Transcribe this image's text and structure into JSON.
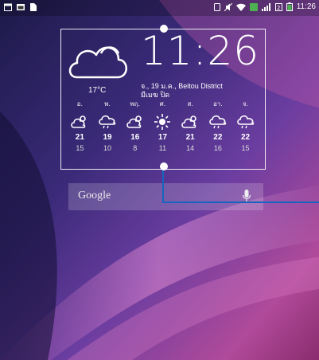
{
  "statusbar": {
    "left_icons": [
      "calendar-icon",
      "message-icon",
      "document-icon"
    ],
    "right_icons": [
      "sim-icon",
      "mute-icon",
      "wifi-icon",
      "app-notification-icon",
      "signal-icon",
      "sim-2-icon",
      "battery-icon"
    ],
    "time": "11:26"
  },
  "widget": {
    "current_icon": "cloud-icon",
    "current_temp": "17°C",
    "time": "11:26",
    "date_line": "จ., 19 ม.ค., Beitou District",
    "date_line2": "มีเมฆ  ปิด",
    "forecast": [
      {
        "day": "อ.",
        "icon": "partly-cloudy-icon",
        "hi": "21",
        "lo": "15"
      },
      {
        "day": "พ.",
        "icon": "cloudy-rain-icon",
        "hi": "19",
        "lo": "10"
      },
      {
        "day": "พฤ.",
        "icon": "partly-cloudy-icon",
        "hi": "16",
        "lo": "8"
      },
      {
        "day": "ศ.",
        "icon": "sunny-icon",
        "hi": "17",
        "lo": "11"
      },
      {
        "day": "ส.",
        "icon": "partly-cloudy-icon",
        "hi": "21",
        "lo": "14"
      },
      {
        "day": "อา.",
        "icon": "cloudy-rain-icon",
        "hi": "22",
        "lo": "16"
      },
      {
        "day": "จ.",
        "icon": "cloudy-rain-icon",
        "hi": "22",
        "lo": "15"
      }
    ]
  },
  "search": {
    "brand": "Google",
    "mic_icon": "microphone-icon"
  },
  "colors": {
    "accent_line": "#1565c0",
    "status_battery": "#4caf50"
  }
}
